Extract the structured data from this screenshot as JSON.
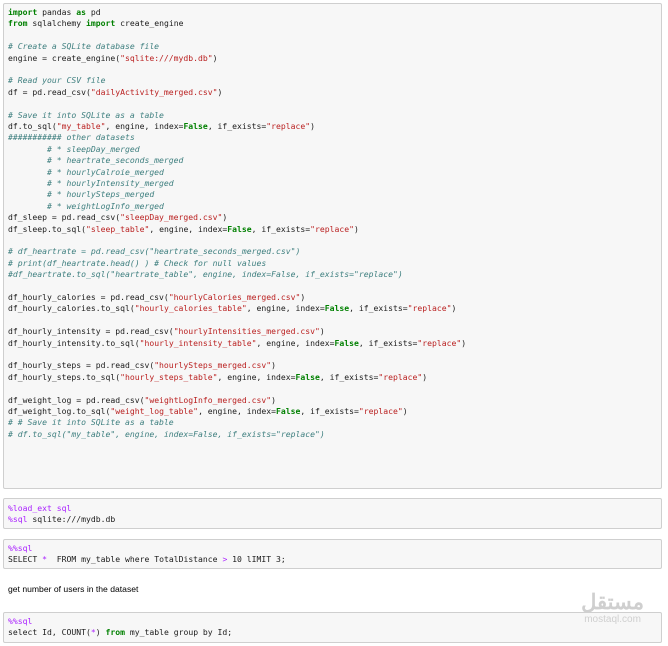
{
  "cell1": {
    "lines": [
      [
        {
          "t": "import",
          "c": "kw"
        },
        {
          "t": " pandas "
        },
        {
          "t": "as",
          "c": "kw"
        },
        {
          "t": " pd"
        }
      ],
      [
        {
          "t": "from",
          "c": "kw"
        },
        {
          "t": " sqlalchemy "
        },
        {
          "t": "import",
          "c": "kw"
        },
        {
          "t": " create_engine"
        }
      ],
      [],
      [
        {
          "t": "# Create a SQLite database file",
          "c": "com"
        }
      ],
      [
        {
          "t": "engine = create_engine("
        },
        {
          "t": "\"sqlite:///mydb.db\"",
          "c": "str"
        },
        {
          "t": ")"
        }
      ],
      [],
      [
        {
          "t": "# Read your CSV file",
          "c": "com"
        }
      ],
      [
        {
          "t": "df = pd.read_csv("
        },
        {
          "t": "\"dailyActivity_merged.csv\"",
          "c": "str"
        },
        {
          "t": ")"
        }
      ],
      [],
      [
        {
          "t": "# Save it into SQLite as a table",
          "c": "com"
        }
      ],
      [
        {
          "t": "df.to_sql("
        },
        {
          "t": "\"my_table\"",
          "c": "str"
        },
        {
          "t": ", engine, index="
        },
        {
          "t": "False",
          "c": "kw"
        },
        {
          "t": ", if_exists="
        },
        {
          "t": "\"replace\"",
          "c": "str"
        },
        {
          "t": ")"
        }
      ],
      [
        {
          "t": "########### other datasets",
          "c": "com"
        }
      ],
      [
        {
          "t": "        # * sleepDay_merged",
          "c": "com"
        }
      ],
      [
        {
          "t": "        # * heartrate_seconds_merged",
          "c": "com"
        }
      ],
      [
        {
          "t": "        # * hourlyCalroie_merged",
          "c": "com"
        }
      ],
      [
        {
          "t": "        # * hourlyIntensity_merged",
          "c": "com"
        }
      ],
      [
        {
          "t": "        # * hourlySteps_merged",
          "c": "com"
        }
      ],
      [
        {
          "t": "        # * weightLogInfo_merged",
          "c": "com"
        }
      ],
      [
        {
          "t": "df_sleep = pd.read_csv("
        },
        {
          "t": "\"sleepDay_merged.csv\"",
          "c": "str"
        },
        {
          "t": ")"
        }
      ],
      [
        {
          "t": "df_sleep.to_sql("
        },
        {
          "t": "\"sleep_table\"",
          "c": "str"
        },
        {
          "t": ", engine, index="
        },
        {
          "t": "False",
          "c": "kw"
        },
        {
          "t": ", if_exists="
        },
        {
          "t": "\"replace\"",
          "c": "str"
        },
        {
          "t": ")"
        }
      ],
      [],
      [
        {
          "t": "# df_heartrate = pd.read_csv(\"heartrate_seconds_merged.csv\")",
          "c": "com"
        }
      ],
      [
        {
          "t": "# print(df_heartrate.head() ) # Check for null values",
          "c": "com"
        }
      ],
      [
        {
          "t": "#df_heartrate.to_sql(\"heartrate_table\", engine, index=False, if_exists=\"replace\")",
          "c": "com"
        }
      ],
      [],
      [
        {
          "t": "df_hourly_calories = pd.read_csv("
        },
        {
          "t": "\"hourlyCalories_merged.csv\"",
          "c": "str"
        },
        {
          "t": ")"
        }
      ],
      [
        {
          "t": "df_hourly_calories.to_sql("
        },
        {
          "t": "\"hourly_calories_table\"",
          "c": "str"
        },
        {
          "t": ", engine, index="
        },
        {
          "t": "False",
          "c": "kw"
        },
        {
          "t": ", if_exists="
        },
        {
          "t": "\"replace\"",
          "c": "str"
        },
        {
          "t": ")"
        }
      ],
      [],
      [
        {
          "t": "df_hourly_intensity = pd.read_csv("
        },
        {
          "t": "\"hourlyIntensities_merged.csv\"",
          "c": "str"
        },
        {
          "t": ")"
        }
      ],
      [
        {
          "t": "df_hourly_intensity.to_sql("
        },
        {
          "t": "\"hourly_intensity_table\"",
          "c": "str"
        },
        {
          "t": ", engine, index="
        },
        {
          "t": "False",
          "c": "kw"
        },
        {
          "t": ", if_exists="
        },
        {
          "t": "\"replace\"",
          "c": "str"
        },
        {
          "t": ")"
        }
      ],
      [],
      [
        {
          "t": "df_hourly_steps = pd.read_csv("
        },
        {
          "t": "\"hourlySteps_merged.csv\"",
          "c": "str"
        },
        {
          "t": ")"
        }
      ],
      [
        {
          "t": "df_hourly_steps.to_sql("
        },
        {
          "t": "\"hourly_steps_table\"",
          "c": "str"
        },
        {
          "t": ", engine, index="
        },
        {
          "t": "False",
          "c": "kw"
        },
        {
          "t": ", if_exists="
        },
        {
          "t": "\"replace\"",
          "c": "str"
        },
        {
          "t": ")"
        }
      ],
      [],
      [
        {
          "t": "df_weight_log = pd.read_csv("
        },
        {
          "t": "\"weightLogInfo_merged.csv\"",
          "c": "str"
        },
        {
          "t": ")"
        }
      ],
      [
        {
          "t": "df_weight_log.to_sql("
        },
        {
          "t": "\"weight_log_table\"",
          "c": "str"
        },
        {
          "t": ", engine, index="
        },
        {
          "t": "False",
          "c": "kw"
        },
        {
          "t": ", if_exists="
        },
        {
          "t": "\"replace\"",
          "c": "str"
        },
        {
          "t": ")"
        }
      ],
      [
        {
          "t": "# # Save it into SQLite as a table",
          "c": "com"
        }
      ],
      [
        {
          "t": "# df.to_sql(\"my_table\", engine, index=False, if_exists=\"replace\")",
          "c": "com"
        }
      ]
    ]
  },
  "cell2": {
    "lines": [
      [
        {
          "t": "%load_ext sql",
          "c": "mag"
        }
      ],
      [
        {
          "t": "%sql",
          "c": "mag"
        },
        {
          "t": " sqlite:///mydb.db"
        }
      ]
    ]
  },
  "cell3": {
    "lines": [
      [
        {
          "t": "%%sql",
          "c": "mag"
        }
      ],
      [
        {
          "t": "SELECT "
        },
        {
          "t": "*",
          "c": "mag"
        },
        {
          "t": "  FROM my_table where TotalDistance "
        },
        {
          "t": ">",
          "c": "mag"
        },
        {
          "t": " 10 lIMIT 3;"
        }
      ]
    ]
  },
  "markdown": {
    "text": "get number of users in the dataset"
  },
  "cell4": {
    "lines": [
      [
        {
          "t": "%%sql",
          "c": "mag"
        }
      ],
      [
        {
          "t": "select Id, COUNT("
        },
        {
          "t": "*",
          "c": "mag"
        },
        {
          "t": ") "
        },
        {
          "t": "from",
          "c": "kw"
        },
        {
          "t": " my_table group by Id;"
        }
      ]
    ]
  },
  "watermark": {
    "arabic": "مستقل",
    "latin": "mostaql.com"
  }
}
